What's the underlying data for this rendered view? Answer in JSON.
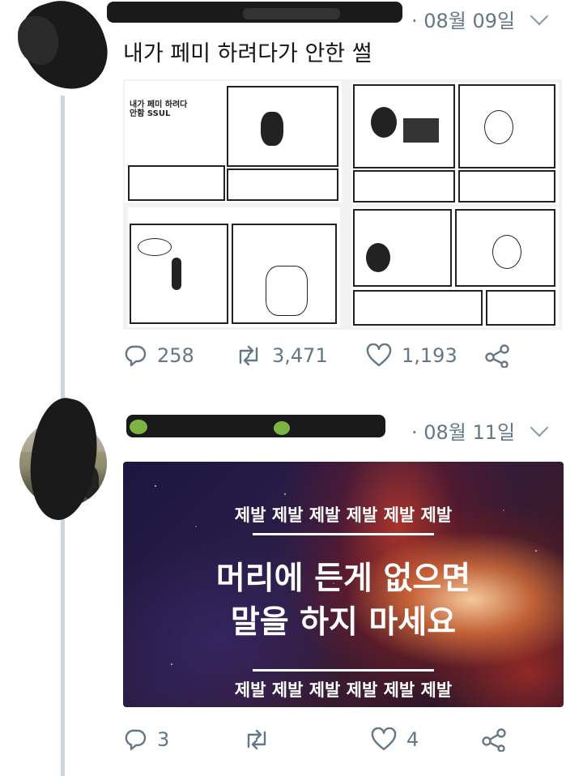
{
  "tweet1": {
    "date": "· 08월 09일",
    "text": "내가 페미 하려다가 안한 썰",
    "comic_title": "내가 페미 하려다 안함 SSUL",
    "replies": "258",
    "retweets": "3,471",
    "likes": "1,193"
  },
  "tweet2": {
    "date": "· 08월 11일",
    "card": {
      "top_line": "제발 제발 제발 제발 제발 제발",
      "main_line1": "머리에 든게 없으면",
      "main_line2": "말을 하지 마세요",
      "bottom_line": "제발 제발 제발 제발 제발 제발"
    },
    "replies": "3",
    "retweets": "",
    "likes": "4"
  },
  "icons": [
    "reply-icon",
    "retweet-icon",
    "heart-icon",
    "share-icon",
    "chevron-down-icon"
  ],
  "colors": {
    "meta_gray": "#657786",
    "thread_line": "#ccd6dd"
  }
}
